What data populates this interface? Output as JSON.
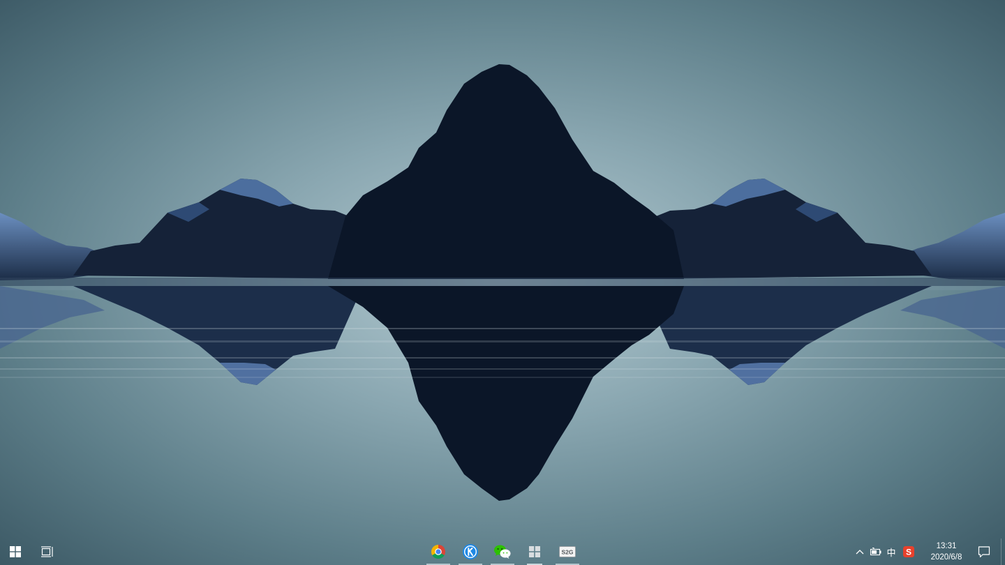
{
  "taskbar": {
    "start": {
      "icon": "windows-logo-icon"
    },
    "task_view": {
      "icon": "task-view-icon"
    },
    "pinned_apps": [
      {
        "name": "Google Chrome",
        "icon": "chrome-icon",
        "running": true
      },
      {
        "name": "KuGou Music",
        "icon": "kugou-icon",
        "running": true
      },
      {
        "name": "WeChat",
        "icon": "wechat-icon",
        "running": true
      },
      {
        "name": "Windows Store",
        "icon": "windows-store-icon",
        "running": true,
        "active": true
      },
      {
        "name": "S2G",
        "icon": "s2g-icon",
        "label": "S2G",
        "running": true
      }
    ],
    "tray": {
      "overflow_icon": "chevron-up-icon",
      "battery_icon": "battery-icon",
      "ime_mode": "中",
      "sogou_icon": "sogou-input-icon",
      "sogou_letter": "S"
    },
    "clock": {
      "time": "13:31",
      "date": "2020/6/8"
    },
    "notification_icon": "action-center-icon"
  },
  "colors": {
    "sky_top": "#3f5d69",
    "sky_glow": "#a9c3cb",
    "mountain_dark": "#0b1628",
    "snow": "#5b7fb0",
    "chrome_red": "#db4437",
    "chrome_yellow": "#f4b400",
    "chrome_green": "#0f9d58",
    "chrome_blue": "#4285f4",
    "kugou_blue": "#1e88e5",
    "wechat_green": "#2dc100",
    "sogou_red": "#e8412c"
  }
}
